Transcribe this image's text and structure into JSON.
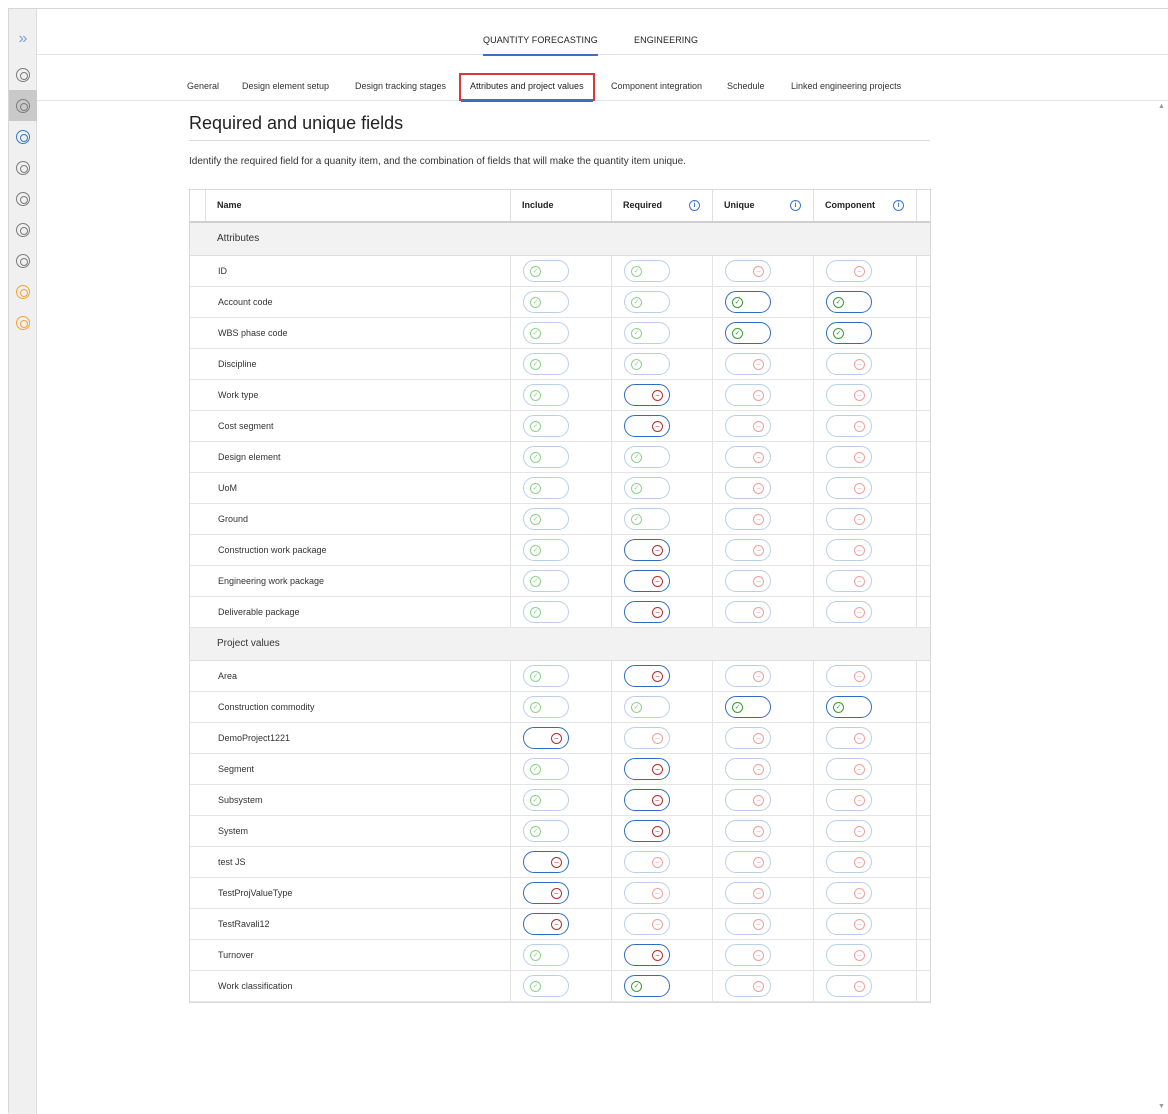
{
  "rail": {
    "expand_glyph": "»",
    "icons": [
      {
        "name": "module-icon-1",
        "tone": "grey",
        "active": false
      },
      {
        "name": "module-icon-2",
        "tone": "grey",
        "active": true
      },
      {
        "name": "module-icon-3",
        "tone": "blue",
        "active": false
      },
      {
        "name": "module-icon-4",
        "tone": "grey",
        "active": false
      },
      {
        "name": "module-icon-5",
        "tone": "grey",
        "active": false
      },
      {
        "name": "module-icon-6",
        "tone": "grey",
        "active": false
      },
      {
        "name": "module-icon-7",
        "tone": "grey",
        "active": false
      },
      {
        "name": "module-icon-8",
        "tone": "orange",
        "active": false
      },
      {
        "name": "module-icon-9",
        "tone": "orange",
        "active": false
      }
    ]
  },
  "topnav": {
    "tabs": [
      {
        "label": "QUANTITY FORECASTING",
        "active": true
      },
      {
        "label": "ENGINEERING",
        "active": false
      }
    ]
  },
  "subnav": {
    "tabs": [
      {
        "label": "General",
        "active": false
      },
      {
        "label": "Design element setup",
        "active": false
      },
      {
        "label": "Design tracking stages",
        "active": false
      },
      {
        "label": "Attributes and project values",
        "active": true
      },
      {
        "label": "Component integration",
        "active": false
      },
      {
        "label": "Schedule",
        "active": false
      },
      {
        "label": "Linked engineering projects",
        "active": false
      }
    ]
  },
  "page": {
    "title": "Required and unique fields",
    "description": "Identify the required field for a quanity item, and the combination of fields that will make the quantity item unique."
  },
  "table": {
    "columns": {
      "name": "Name",
      "include": "Include",
      "required": "Required",
      "unique": "Unique",
      "component": "Component"
    },
    "info_glyph": "i",
    "groups": [
      {
        "label": "Attributes",
        "rows": [
          {
            "name": "ID",
            "include": "on-dis",
            "required": "on-dis",
            "unique": "off-dis",
            "component": "off-dis"
          },
          {
            "name": "Account code",
            "include": "on-dis",
            "required": "on-dis",
            "unique": "on-act",
            "component": "on-act"
          },
          {
            "name": "WBS phase code",
            "include": "on-dis",
            "required": "on-dis",
            "unique": "on-act",
            "component": "on-act"
          },
          {
            "name": "Discipline",
            "include": "on-dis",
            "required": "on-dis",
            "unique": "off-dis",
            "component": "off-dis"
          },
          {
            "name": "Work type",
            "include": "on-dis",
            "required": "off-act",
            "unique": "off-dis",
            "component": "off-dis"
          },
          {
            "name": "Cost segment",
            "include": "on-dis",
            "required": "off-act",
            "unique": "off-dis",
            "component": "off-dis"
          },
          {
            "name": "Design element",
            "include": "on-dis",
            "required": "on-dis",
            "unique": "off-dis",
            "component": "off-dis"
          },
          {
            "name": "UoM",
            "include": "on-dis",
            "required": "on-dis",
            "unique": "off-dis",
            "component": "off-dis"
          },
          {
            "name": "Ground",
            "include": "on-dis",
            "required": "on-dis",
            "unique": "off-dis",
            "component": "off-dis"
          },
          {
            "name": "Construction work package",
            "include": "on-dis",
            "required": "off-act",
            "unique": "off-dis",
            "component": "off-dis"
          },
          {
            "name": "Engineering work package",
            "include": "on-dis",
            "required": "off-act",
            "unique": "off-dis",
            "component": "off-dis"
          },
          {
            "name": "Deliverable package",
            "include": "on-dis",
            "required": "off-act",
            "unique": "off-dis",
            "component": "off-dis"
          }
        ]
      },
      {
        "label": "Project values",
        "rows": [
          {
            "name": "Area",
            "include": "on-dis",
            "required": "off-act",
            "unique": "off-dis",
            "component": "off-dis"
          },
          {
            "name": "Construction commodity",
            "include": "on-dis",
            "required": "on-dis",
            "unique": "on-act",
            "component": "on-act"
          },
          {
            "name": "DemoProject1221",
            "include": "off-act",
            "required": "off-dis",
            "unique": "off-dis",
            "component": "off-dis"
          },
          {
            "name": "Segment",
            "include": "on-dis",
            "required": "off-act",
            "unique": "off-dis",
            "component": "off-dis"
          },
          {
            "name": "Subsystem",
            "include": "on-dis",
            "required": "off-act",
            "unique": "off-dis",
            "component": "off-dis"
          },
          {
            "name": "System",
            "include": "on-dis",
            "required": "off-act",
            "unique": "off-dis",
            "component": "off-dis"
          },
          {
            "name": "test JS",
            "include": "off-act",
            "required": "off-dis",
            "unique": "off-dis",
            "component": "off-dis"
          },
          {
            "name": "TestProjValueType",
            "include": "off-act",
            "required": "off-dis",
            "unique": "off-dis",
            "component": "off-dis"
          },
          {
            "name": "TestRavali12",
            "include": "off-act",
            "required": "off-dis",
            "unique": "off-dis",
            "component": "off-dis"
          },
          {
            "name": "Turnover",
            "include": "on-dis",
            "required": "off-act",
            "unique": "off-dis",
            "component": "off-dis"
          },
          {
            "name": "Work classification",
            "include": "on-dis",
            "required": "on-act",
            "unique": "off-dis",
            "component": "off-dis"
          }
        ]
      }
    ]
  }
}
